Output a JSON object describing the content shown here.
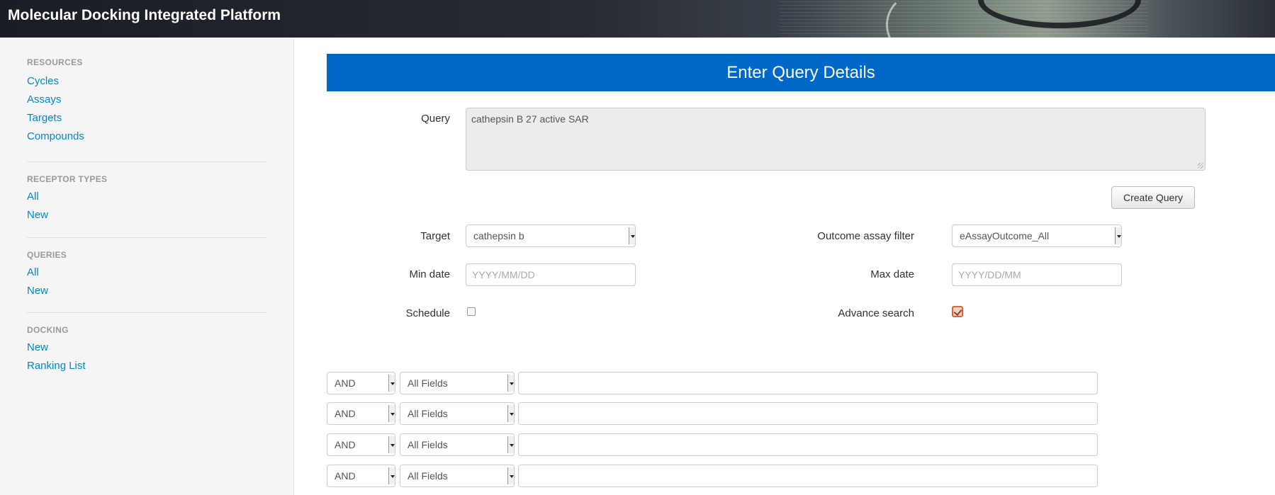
{
  "app": {
    "title": "Molecular Docking Integrated Platform"
  },
  "sidebar": {
    "sections": [
      {
        "header": "RESOURCES",
        "links": [
          "Cycles",
          "Assays",
          "Targets",
          "Compounds"
        ]
      },
      {
        "header": "RECEPTOR TYPES",
        "links": [
          "All",
          "New"
        ]
      },
      {
        "header": "QUERIES",
        "links": [
          "All",
          "New"
        ]
      },
      {
        "header": "DOCKING",
        "links": [
          "New",
          "Ranking List"
        ]
      }
    ]
  },
  "form": {
    "heading": "Enter Query Details",
    "query_label": "Query",
    "query_value": "cathepsin B 27 active SAR",
    "create_button": "Create Query",
    "target_label": "Target",
    "target_value": "cathepsin b",
    "outcome_label": "Outcome assay filter",
    "outcome_value": "eAssayOutcome_All",
    "min_date_label": "Min date",
    "min_date_placeholder": "YYYY/MM/DD",
    "max_date_label": "Max date",
    "max_date_placeholder": "YYYY/DD/MM",
    "schedule_label": "Schedule",
    "schedule_checked": false,
    "advance_label": "Advance search",
    "advance_checked": true
  },
  "advanced_rows": [
    {
      "operator": "AND",
      "field": "All Fields",
      "value": ""
    },
    {
      "operator": "AND",
      "field": "All Fields",
      "value": ""
    },
    {
      "operator": "AND",
      "field": "All Fields",
      "value": ""
    },
    {
      "operator": "AND",
      "field": "All Fields",
      "value": ""
    }
  ],
  "colors": {
    "header_blue": "#0068c9",
    "link": "#0088cc",
    "checkbox_accent": "#d9653b"
  }
}
